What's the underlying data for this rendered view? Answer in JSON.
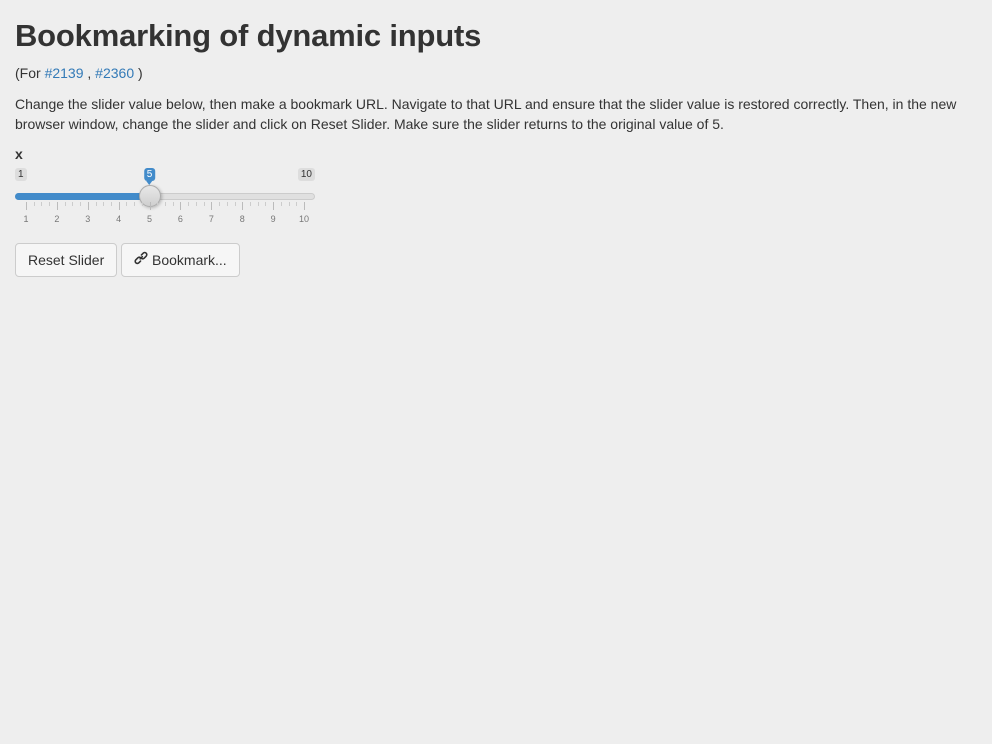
{
  "page": {
    "title": "Bookmarking of dynamic inputs",
    "refs": {
      "prefix": "(For",
      "separator": ",",
      "suffix": ")",
      "links": [
        "#2139",
        "#2360"
      ]
    },
    "instructions": "Change the slider value below, then make a bookmark URL. Navigate to that URL and ensure that the slider value is restored correctly. Then, in the new browser window, change the slider and click on Reset Slider. Make sure the slider returns to the original value of 5."
  },
  "slider": {
    "label": "x",
    "min": 1,
    "max": 10,
    "value": 5,
    "min_label": "1",
    "max_label": "10",
    "value_label": "5",
    "tick_labels": [
      "1",
      "2",
      "3",
      "4",
      "5",
      "6",
      "7",
      "8",
      "9",
      "10"
    ]
  },
  "buttons": {
    "reset_label": "Reset Slider",
    "bookmark_label": "Bookmark...",
    "bookmark_icon": "link-icon"
  },
  "colors": {
    "background": "#eeeeee",
    "accent": "#428bca",
    "link": "#337ab7"
  }
}
